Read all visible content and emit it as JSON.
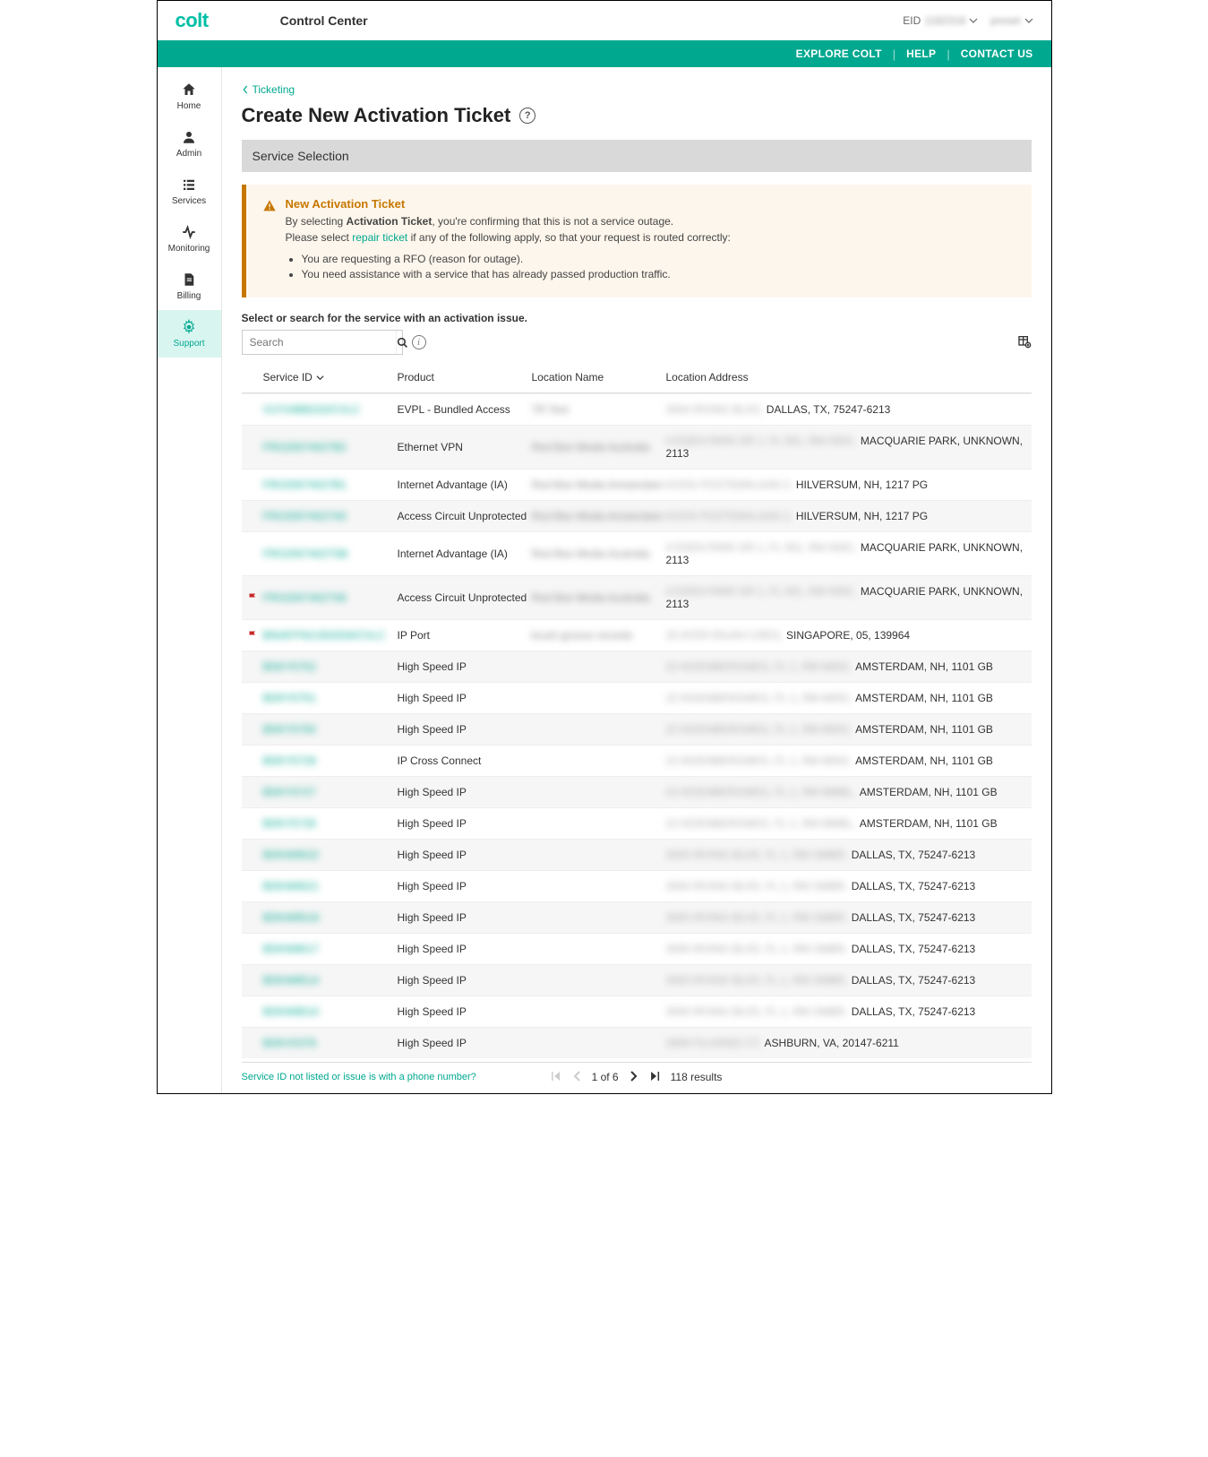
{
  "header": {
    "logo": "colt",
    "app_title": "Control Center",
    "eid_label": "EID",
    "eid_value": "1182318",
    "user_value": "preset",
    "topnav": {
      "explore": "EXPLORE COLT",
      "help": "HELP",
      "contact": "CONTACT US"
    }
  },
  "sidebar": {
    "items": [
      {
        "label": "Home"
      },
      {
        "label": "Admin"
      },
      {
        "label": "Services"
      },
      {
        "label": "Monitoring"
      },
      {
        "label": "Billing"
      },
      {
        "label": "Support"
      }
    ]
  },
  "breadcrumb": {
    "label": "Ticketing"
  },
  "page": {
    "title": "Create New Activation Ticket"
  },
  "section": {
    "title": "Service Selection"
  },
  "alert": {
    "title": "New Activation Ticket",
    "line1_pre": "By selecting ",
    "line1_bold": "Activation Ticket",
    "line1_post": ", you're confirming that this is not a service outage.",
    "line2_pre": "Please select ",
    "line2_link": "repair ticket",
    "line2_post": " if any of the following apply, so that your request is routed correctly:",
    "bullets": [
      "You are requesting a RFO (reason for outage).",
      "You need assistance with a service that has already passed production traffic."
    ]
  },
  "search": {
    "label": "Select or search for the service with an activation issue.",
    "placeholder": "Search"
  },
  "table": {
    "columns": {
      "service_id": "Service ID",
      "product": "Product",
      "location_name": "Location Name",
      "location_address": "Location Address"
    },
    "rows": [
      {
        "flag": false,
        "svc": "VLFX/888102/CVLC",
        "product": "EVPL - Bundled Access",
        "loc_name": "TR Test",
        "addr_blur": "3004 IRVING BLVD,",
        "addr_clear": "DALLAS, TX, 75247-6213"
      },
      {
        "flag": false,
        "svc": "FRO20074027B2",
        "product": "Ethernet VPN",
        "loc_name": "Red Bee Media Australia",
        "addr_blur": "4 EDEN PARK DR 1, FL 001, RM 000C,",
        "addr_clear": "MACQUARIE PARK, UNKNOWN, 2113"
      },
      {
        "flag": false,
        "svc": "FRO20074027B1",
        "product": "Internet Advantage (IA)",
        "loc_name": "Red Bee Media Amsterdam",
        "addr_blur": "KOOS POSTEMALAAN 2,",
        "addr_clear": "HILVERSUM, NH, 1217 PG"
      },
      {
        "flag": false,
        "svc": "FRO20074027A0",
        "product": "Access Circuit Unprotected",
        "loc_name": "Red Bee Media Amsterdam",
        "addr_blur": "KOOS POSTEMALAAN 2,",
        "addr_clear": "HILVERSUM, NH, 1217 PG"
      },
      {
        "flag": false,
        "svc": "FRO20074027SB",
        "product": "Internet Advantage (IA)",
        "loc_name": "Red Bee Media Australia",
        "addr_blur": "4 EDEN PARK DR 1, FL 001, RM 000C,",
        "addr_clear": "MACQUARIE PARK, UNKNOWN, 2113"
      },
      {
        "flag": true,
        "svc": "FRO20074027S6",
        "product": "Access Circuit Unprotected",
        "loc_name": "Red Bee Media Australia",
        "addr_blur": "4 EDEN PARK DR 1, FL 001, RM 000C,",
        "addr_clear": "MACQUARIE PARK, UNKNOWN, 2113"
      },
      {
        "flag": true,
        "svc": "BN/AFFN/1302034/CVLC",
        "product": "IP Port",
        "loc_name": "krush groove records",
        "addr_blur": "20 AYER RAJAH CRES,",
        "addr_clear": "SINGAPORE, 05, 139964"
      },
      {
        "flag": false,
        "svc": "BDKY5752",
        "product": "High Speed IP",
        "loc_name": "",
        "addr_blur": "22 KEIENBERGWEG, FL 1, RM M002,",
        "addr_clear": "AMSTERDAM, NH, 1101 GB"
      },
      {
        "flag": false,
        "svc": "BDKY5751",
        "product": "High Speed IP",
        "loc_name": "",
        "addr_blur": "22 KEIENBERGWEG, FL 1, RM M002,",
        "addr_clear": "AMSTERDAM, NH, 1101 GB"
      },
      {
        "flag": false,
        "svc": "BDKY5750",
        "product": "High Speed IP",
        "loc_name": "",
        "addr_blur": "22 KEIENBERGWEG, FL 1, RM M002,",
        "addr_clear": "AMSTERDAM, NH, 1101 GB"
      },
      {
        "flag": false,
        "svc": "BDKY5728",
        "product": "IP Cross Connect",
        "loc_name": "",
        "addr_blur": "22 KEIENBERGWEG, FL 1, RM M002,",
        "addr_clear": "AMSTERDAM, NH, 1101 GB"
      },
      {
        "flag": false,
        "svc": "BDKY5727",
        "product": "High Speed IP",
        "loc_name": "",
        "addr_blur": "22 KEIENBERGWEG, FL 1, RM MMBL,",
        "addr_clear": "AMSTERDAM, NH, 1101 GB"
      },
      {
        "flag": false,
        "svc": "BDKY5726",
        "product": "High Speed IP",
        "loc_name": "",
        "addr_blur": "22 KEIENBERGWEG, FL 1, RM MMBL,",
        "addr_clear": "AMSTERDAM, NH, 1101 GB"
      },
      {
        "flag": false,
        "svc": "BDKW8522",
        "product": "High Speed IP",
        "loc_name": "",
        "addr_blur": "3000 IRVING BLVD, FL 1, RM OMBR,",
        "addr_clear": "DALLAS, TX, 75247-6213"
      },
      {
        "flag": false,
        "svc": "BDKW8521",
        "product": "High Speed IP",
        "loc_name": "",
        "addr_blur": "3000 IRVING BLVD, FL 1, RM OMBR,",
        "addr_clear": "DALLAS, TX, 75247-6213"
      },
      {
        "flag": false,
        "svc": "BDKW8518",
        "product": "High Speed IP",
        "loc_name": "",
        "addr_blur": "3000 IRVING BLVD, FL 1, RM OMBR,",
        "addr_clear": "DALLAS, TX, 75247-6213"
      },
      {
        "flag": false,
        "svc": "BDKW8517",
        "product": "High Speed IP",
        "loc_name": "",
        "addr_blur": "3000 IRVING BLVD, FL 1, RM OMBR,",
        "addr_clear": "DALLAS, TX, 75247-6213"
      },
      {
        "flag": false,
        "svc": "BDKW8514",
        "product": "High Speed IP",
        "loc_name": "",
        "addr_blur": "3000 IRVING BLVD, FL 1, RM OMBR,",
        "addr_clear": "DALLAS, TX, 75247-6213"
      },
      {
        "flag": false,
        "svc": "BDKW8510",
        "product": "High Speed IP",
        "loc_name": "",
        "addr_blur": "3000 IRVING BLVD, FL 1, RM OMBR,",
        "addr_clear": "DALLAS, TX, 75247-6213"
      },
      {
        "flag": false,
        "svc": "BDKV5378",
        "product": "High Speed IP",
        "loc_name": "",
        "addr_blur": "2809 FILIGREE CT,",
        "addr_clear": "ASHBURN, VA, 20147-6211"
      }
    ]
  },
  "footer": {
    "help_link": "Service ID not listed or issue is with a phone number?",
    "page_info": "1 of 6",
    "results": "118 results"
  }
}
